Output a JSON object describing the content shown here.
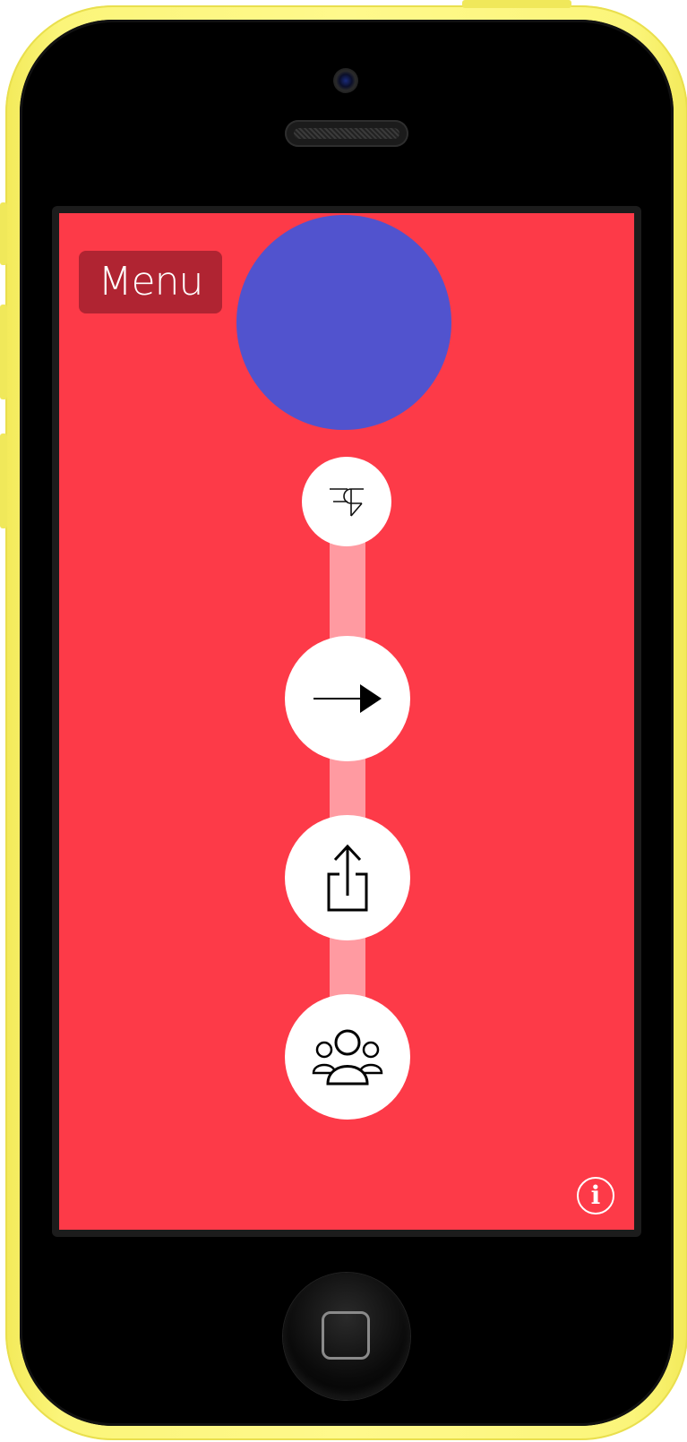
{
  "device": {
    "model": "iPhone 5c",
    "shell_color": "#fbf57a",
    "screen_background": "#fd3a48"
  },
  "screen": {
    "menu_button": {
      "label": "Menu",
      "background": "#b02432"
    },
    "avatar_circle": {
      "color": "#5153ce"
    },
    "timeline_track_color": "#ff9aa1",
    "nodes": [
      {
        "icon": "brand-logo-icon"
      },
      {
        "icon": "arrow-right-icon"
      },
      {
        "icon": "share-icon"
      },
      {
        "icon": "group-icon"
      }
    ],
    "info_button": {
      "glyph": "i",
      "icon": "info-icon"
    }
  }
}
